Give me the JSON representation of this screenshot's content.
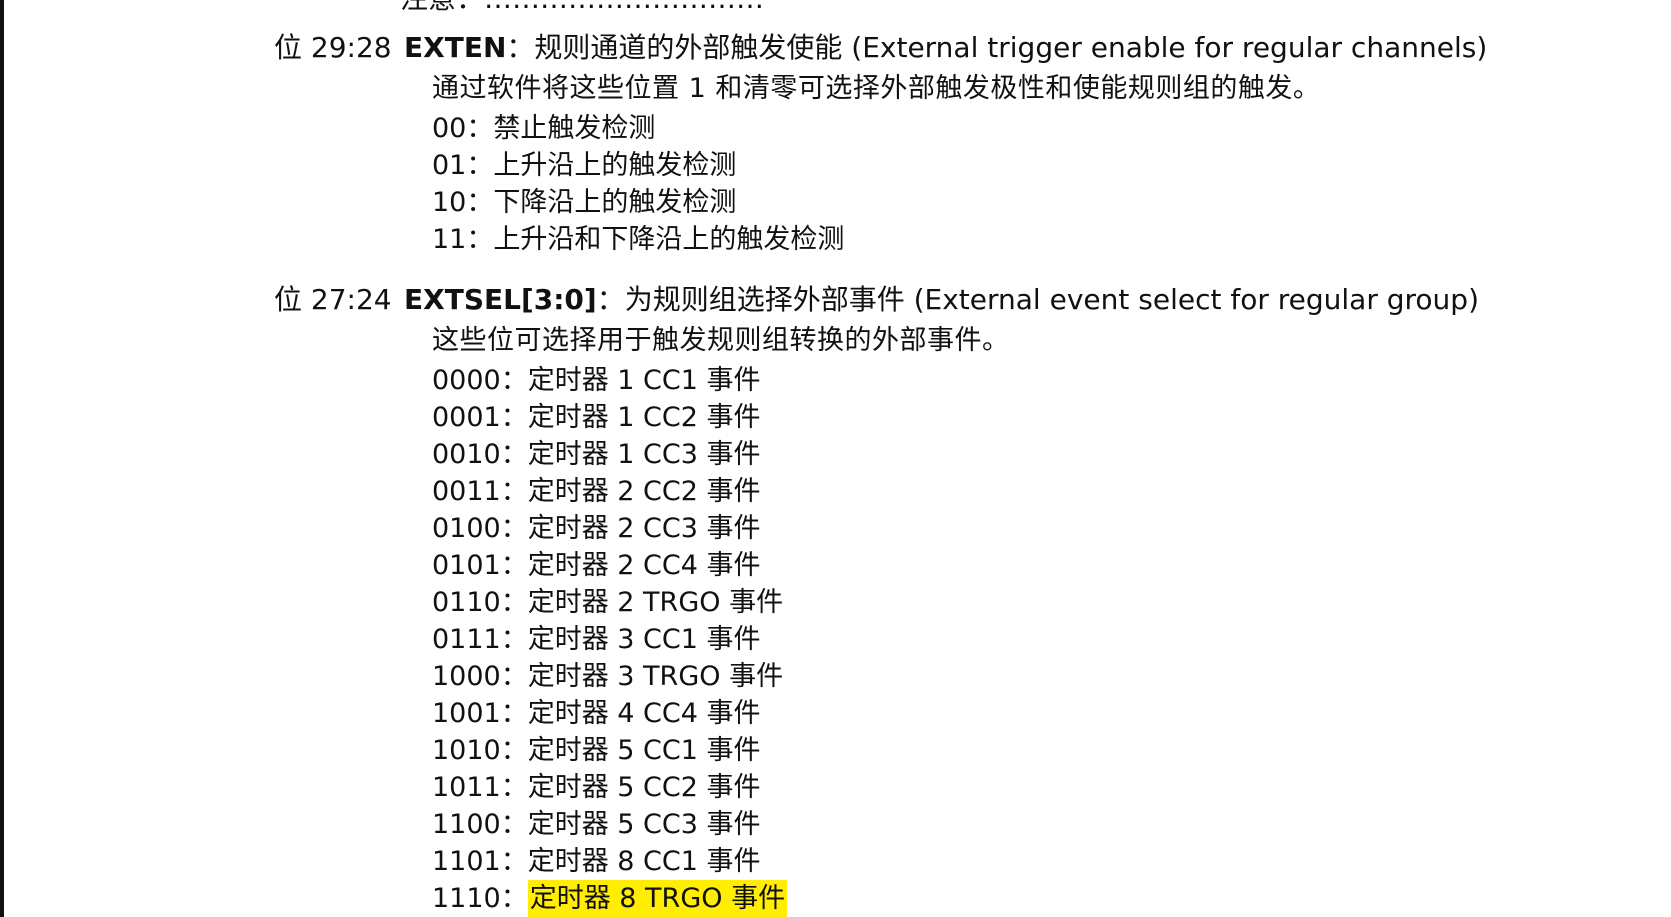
{
  "top_fragment": "注意：…………………………",
  "exten": {
    "bit_label": "位 29:28",
    "name": "EXTEN",
    "title_rest": "：规则通道的外部触发使能 (External trigger enable for regular channels)",
    "description": "通过软件将这些位置 1 和清零可选择外部触发极性和使能规则组的触发。",
    "options": [
      {
        "code": "00",
        "sep": "：",
        "text": "禁止触发检测"
      },
      {
        "code": "01",
        "sep": "：",
        "text": "上升沿上的触发检测"
      },
      {
        "code": "10",
        "sep": "：",
        "text": "下降沿上的触发检测"
      },
      {
        "code": "11",
        "sep": "：",
        "text": "上升沿和下降沿上的触发检测"
      }
    ]
  },
  "extsel": {
    "bit_label": "位 27:24",
    "name": "EXTSEL[3:0]",
    "title_rest": "：为规则组选择外部事件 (External event select for regular group)",
    "description": "这些位可选择用于触发规则组转换的外部事件。",
    "options": [
      {
        "code": "0000",
        "sep": "：",
        "text": "定时器 1 CC1 事件"
      },
      {
        "code": "0001",
        "sep": "：",
        "text": "定时器 1 CC2 事件"
      },
      {
        "code": "0010",
        "sep": "：",
        "text": "定时器 1 CC3 事件"
      },
      {
        "code": "0011",
        "sep": "：",
        "text": "定时器 2 CC2 事件"
      },
      {
        "code": "0100",
        "sep": "：",
        "text": "定时器 2 CC3 事件"
      },
      {
        "code": "0101",
        "sep": "：",
        "text": "定时器 2 CC4 事件"
      },
      {
        "code": "0110",
        "sep": "：",
        "text": "定时器 2 TRGO 事件"
      },
      {
        "code": "0111",
        "sep": "：",
        "text": "定时器 3 CC1 事件"
      },
      {
        "code": "1000",
        "sep": "：",
        "text": "定时器 3 TRGO 事件"
      },
      {
        "code": "1001",
        "sep": "：",
        "text": "定时器 4 CC4 事件"
      },
      {
        "code": "1010",
        "sep": "：",
        "text": "定时器 5 CC1 事件"
      },
      {
        "code": "1011",
        "sep": "：",
        "text": "定时器 5 CC2 事件"
      },
      {
        "code": "1100",
        "sep": "：",
        "text": "定时器 5 CC3 事件"
      },
      {
        "code": "1101",
        "sep": "：",
        "text": "定时器 8 CC1 事件"
      },
      {
        "code": "1110",
        "sep": "：",
        "text": "定时器 8 TRGO 事件"
      }
    ]
  },
  "highlight": {
    "color": "#ffee00",
    "highlighted_text": "定时器 8 TRGO 事件"
  }
}
